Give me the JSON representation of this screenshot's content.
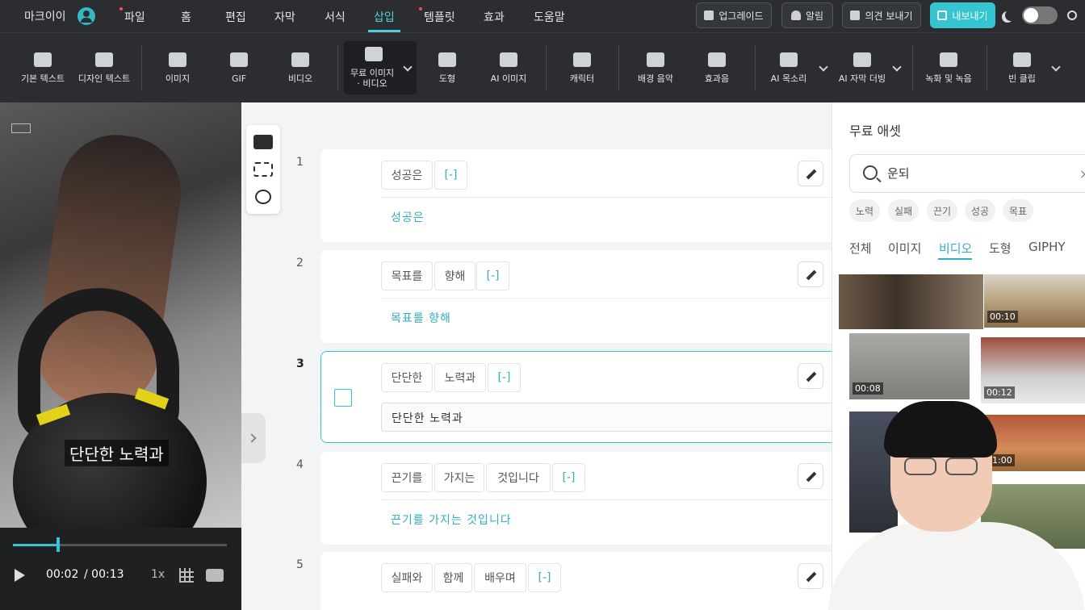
{
  "app": {
    "brand": "마크이이"
  },
  "menu": [
    {
      "label": "파일",
      "dot": true
    },
    {
      "label": "홈",
      "dot": false
    },
    {
      "label": "편집",
      "dot": false
    },
    {
      "label": "자막",
      "dot": false
    },
    {
      "label": "서식",
      "dot": false
    },
    {
      "label": "삽입",
      "dot": false,
      "active": true
    },
    {
      "label": "템플릿",
      "dot": true
    },
    {
      "label": "효과",
      "dot": false
    },
    {
      "label": "도움말",
      "dot": false
    }
  ],
  "top_buttons": {
    "upgrade": "업그레이드",
    "alarm": "알림",
    "feedback": "의견 보내기",
    "export": "내보내기"
  },
  "toolbar": [
    {
      "label": "기본 텍스트",
      "icon": "text-icon"
    },
    {
      "label": "디자인 텍스트",
      "icon": "design-text-icon"
    },
    {
      "label": "이미지",
      "icon": "image-icon"
    },
    {
      "label": "GIF",
      "icon": "gif-icon"
    },
    {
      "label": "비디오",
      "icon": "video-icon"
    },
    {
      "label": "무료 이미지\n· 비디오",
      "icon": "free-asset-icon",
      "active": true
    },
    {
      "label": "도형",
      "icon": "shape-icon"
    },
    {
      "label": "AI 이미지",
      "icon": "ai-image-icon"
    },
    {
      "label": "캐릭터",
      "icon": "character-icon"
    },
    {
      "label": "배경 음악",
      "icon": "music-icon"
    },
    {
      "label": "효과음",
      "icon": "sound-effect-icon"
    },
    {
      "label": "AI 목소리",
      "icon": "ai-voice-icon"
    },
    {
      "label": "AI 자막 더빙",
      "icon": "ai-dubbing-icon"
    },
    {
      "label": "녹화 및 녹음",
      "icon": "record-icon"
    },
    {
      "label": "빈 클립",
      "icon": "blank-clip-icon"
    }
  ],
  "preview": {
    "subtitle": "단단한 노력과",
    "time_current": "00:02",
    "time_total": "/ 00:13",
    "speed": "1x",
    "progress": 0.21
  },
  "script_rows": [
    {
      "num": "1",
      "chips": [
        "성공은",
        "[-]"
      ],
      "text": "성공은"
    },
    {
      "num": "2",
      "chips": [
        "목표를",
        "향해",
        "[-]"
      ],
      "text": "목표를 향해"
    },
    {
      "num": "3",
      "chips": [
        "단단한",
        "노력과",
        "[-]"
      ],
      "text": "단단한 노력과",
      "selected": true
    },
    {
      "num": "4",
      "chips": [
        "끈기를",
        "가지는",
        "것입니다",
        "[-]"
      ],
      "text": "끈기를 가지는 것입니다"
    },
    {
      "num": "5",
      "chips": [
        "실패와",
        "함께",
        "배우며",
        "[-]"
      ],
      "text": ""
    }
  ],
  "asset_panel": {
    "title": "무료 애셋",
    "search_value": "운되",
    "clear": "×",
    "tags": [
      "노력",
      "실패",
      "끈기",
      "성공",
      "목표"
    ],
    "tabs": [
      "전체",
      "이미지",
      "비디오",
      "도형",
      "GIPHY"
    ],
    "active_tab": "비디오",
    "thumbnails": [
      {
        "duration": ""
      },
      {
        "duration": "00:10"
      },
      {
        "duration": "00:08"
      },
      {
        "duration": "00:12"
      },
      {
        "duration": ""
      },
      {
        "duration": "01:00"
      },
      {
        "duration": ""
      }
    ]
  },
  "colors": {
    "accent": "#35c5d0",
    "toolbar_bg": "#2b2d31",
    "selected_border": "#35c5d0"
  }
}
